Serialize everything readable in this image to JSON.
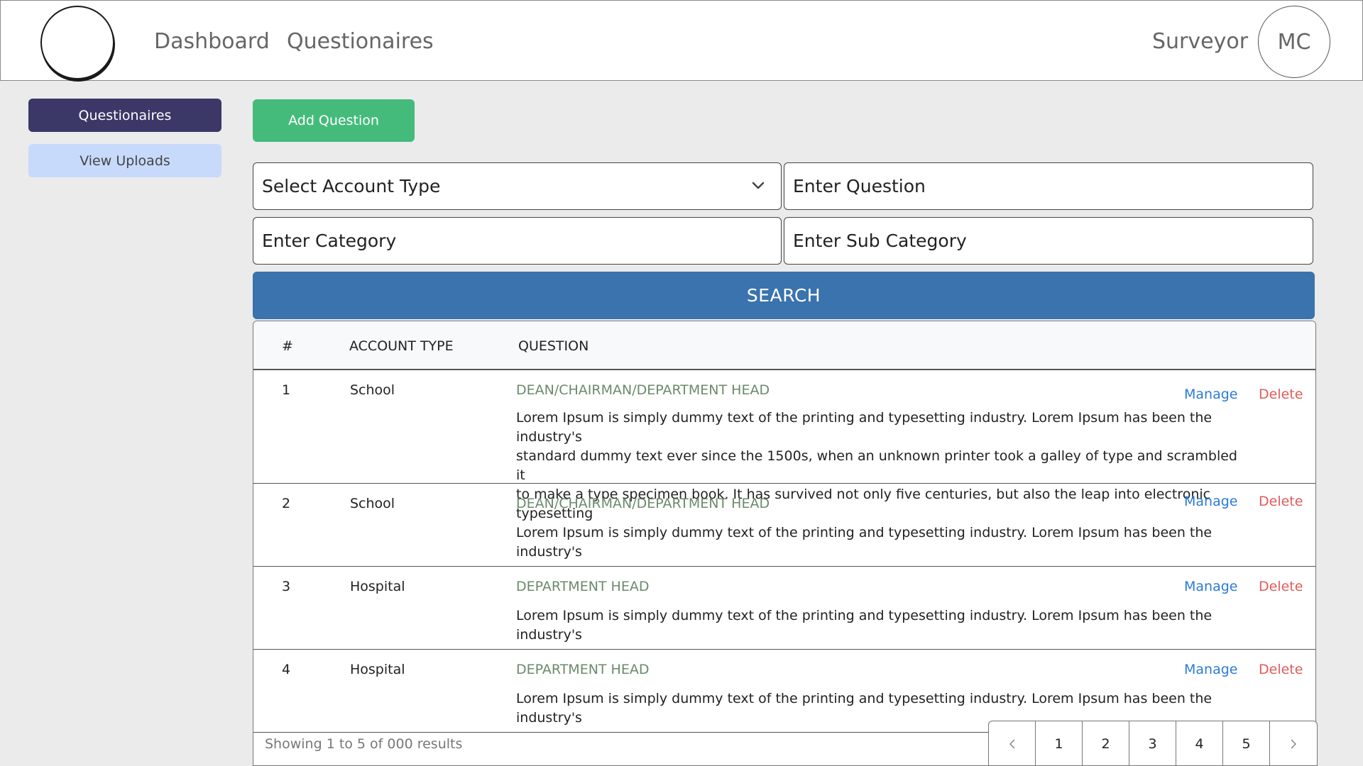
{
  "header": {
    "nav": [
      "Dashboard",
      "Questionaires"
    ],
    "role": "Surveyor",
    "avatar_initials": "MC"
  },
  "sidebar": {
    "items": [
      {
        "label": "Questionaires",
        "active": true
      },
      {
        "label": "View Uploads",
        "active": false
      }
    ]
  },
  "toolbar": {
    "add_label": "Add Question"
  },
  "filters": {
    "account_type_placeholder": "Select Account Type",
    "question_placeholder": "Enter Question",
    "category_placeholder": "Enter Category",
    "subcategory_placeholder": "Enter Sub Category",
    "search_label": "SEARCH"
  },
  "table": {
    "headers": [
      "#",
      "ACCOUNT TYPE",
      "QUESTION"
    ],
    "rows": [
      {
        "num": "1",
        "account_type": "School",
        "category": "DEAN/CHAIRMAN/DEPARTMENT HEAD",
        "lines": [
          "Lorem Ipsum is simply dummy text of the printing and typesetting industry. Lorem Ipsum has been the industry's",
          "standard dummy text ever since the 1500s, when an unknown printer took a galley of type and scrambled it",
          "to make a type specimen book. It has survived not only five centuries, but also the leap into electronic typesetting"
        ],
        "manage": "Manage",
        "delete": "Delete"
      },
      {
        "num": "2",
        "account_type": "School",
        "category": "DEAN/CHAIRMAN/DEPARTMENT HEAD",
        "lines": [
          "Lorem Ipsum is simply dummy text of the printing and typesetting industry. Lorem Ipsum has been the industry's"
        ],
        "manage": "Manage",
        "delete": "Delete"
      },
      {
        "num": "3",
        "account_type": "Hospital",
        "category": "DEPARTMENT HEAD",
        "lines": [
          "Lorem Ipsum is simply dummy text of the printing and typesetting industry. Lorem Ipsum has been the industry's"
        ],
        "manage": "Manage",
        "delete": "Delete"
      },
      {
        "num": "4",
        "account_type": "Hospital",
        "category": "DEPARTMENT HEAD",
        "lines": [
          "Lorem Ipsum is simply dummy text of the printing and typesetting industry. Lorem Ipsum has been the industry's"
        ],
        "manage": "Manage",
        "delete": "Delete"
      }
    ],
    "summary": "Showing 1 to 5 of 000 results"
  },
  "pagination": {
    "pages": [
      "1",
      "2",
      "3",
      "4",
      "5"
    ],
    "prev_icon": "chevron-left-icon",
    "next_icon": "chevron-right-icon"
  },
  "colors": {
    "sidebar_active": "#3b3767",
    "sidebar_inactive": "#c7dafc",
    "add_button": "#45bb7b",
    "search_button": "#3a73ae",
    "manage_link": "#2b7bd6",
    "delete_link": "#e05c5c",
    "category_text": "#6b8a6b"
  }
}
